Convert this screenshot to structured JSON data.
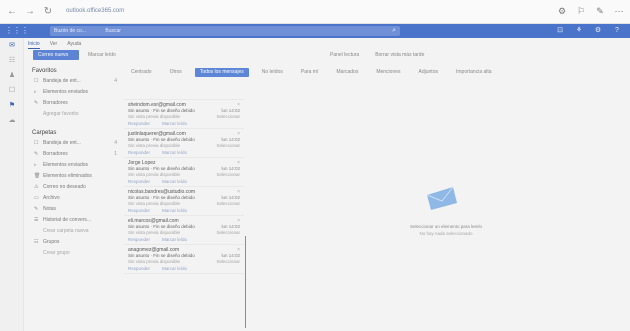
{
  "browser": {
    "url": "outlook.office365.com",
    "nav": [
      "←",
      "→",
      "↻"
    ],
    "right_icons": [
      "⚙",
      "⚐",
      "✎",
      "⋯"
    ]
  },
  "topbar": {
    "apps_icon": "⋮⋮⋮",
    "search_scope": "Buzón de co...",
    "search_placeholder": "Buscar",
    "right_icons": [
      "⊡",
      "⚘",
      "⚙",
      "?"
    ]
  },
  "rail": [
    "✉",
    "☷",
    "♟",
    "☐",
    "⚑",
    "☁"
  ],
  "ribbon": {
    "tabs": [
      "Inicio",
      "Ver",
      "Ayuda"
    ],
    "new_mail": "Correo nuevo",
    "mark_read": "Marcar leído"
  },
  "reading_opts": [
    "Panel lectura",
    "Borrar vista más tarde"
  ],
  "filters": [
    {
      "label": "Centrado",
      "primary": false
    },
    {
      "label": "Otros",
      "primary": false
    },
    {
      "label": "Todos los mensajes",
      "primary": true
    },
    {
      "label": "No leídos",
      "primary": false
    },
    {
      "label": "Para mí",
      "primary": false
    },
    {
      "label": "Marcados",
      "primary": false
    },
    {
      "label": "Menciones",
      "primary": false
    },
    {
      "label": "Adjuntos",
      "primary": false
    },
    {
      "label": "Importancia alta",
      "primary": false
    }
  ],
  "favorites": {
    "title": "Favoritos",
    "items": [
      {
        "icon": "☐",
        "label": "Bandeja de ent...",
        "count": "4"
      },
      {
        "icon": "▹",
        "label": "Elementos enviados",
        "count": ""
      },
      {
        "icon": "✎",
        "label": "Borradores",
        "count": ""
      },
      {
        "icon": "",
        "label": "Agregar favorito",
        "count": "",
        "dim": true
      }
    ]
  },
  "mailbox": {
    "title": "Carpetas",
    "items": [
      {
        "icon": "☐",
        "label": "Bandeja de ent...",
        "count": "4"
      },
      {
        "icon": "✎",
        "label": "Borradores",
        "count": "1"
      },
      {
        "icon": "▹",
        "label": "Elementos enviados",
        "count": ""
      },
      {
        "icon": "🗑",
        "label": "Elementos eliminados",
        "count": ""
      },
      {
        "icon": "⚠",
        "label": "Correo no deseado",
        "count": ""
      },
      {
        "icon": "▭",
        "label": "Archivo",
        "count": ""
      },
      {
        "icon": "✎",
        "label": "Notas",
        "count": ""
      },
      {
        "icon": "☰",
        "label": "Historial de convers...",
        "count": ""
      },
      {
        "icon": "",
        "label": "Crear carpeta nueva",
        "count": "",
        "dim": true
      },
      {
        "icon": "☷",
        "label": "Grupos",
        "count": ""
      },
      {
        "icon": "",
        "label": "Crear grupo",
        "count": "",
        "dim": true
      }
    ]
  },
  "messages": [
    {
      "sender": "",
      "subject": "",
      "time": "",
      "meta": "",
      "tag": ""
    },
    {
      "sender": "sheindom.esr@gmail.com",
      "subject": "Sin asunto · Fin se diseño debido",
      "time": "lun 14:02",
      "meta": "Sin vista previa disponible",
      "tag": "Seleccionar"
    },
    {
      "sender": "justinlaquerer@gmail.com",
      "subject": "Sin asunto · Fin se diseño debido",
      "time": "lun 14:02",
      "meta": "Sin vista previa disponible",
      "tag": "Seleccionar"
    },
    {
      "sender": "Jorge Lopez",
      "subject": "Sin asunto · Fin se diseño debido",
      "time": "lun 14:02",
      "meta": "Sin vista previa disponible",
      "tag": "Seleccionar"
    },
    {
      "sender": "nicolas.bandres@ustudio.com",
      "subject": "Sin asunto · Fin se diseño debido",
      "time": "lun 14:02",
      "meta": "Sin vista previa disponible",
      "tag": "Seleccionar"
    },
    {
      "sender": "eli.marcos@gmail.com",
      "subject": "Sin asunto · Fin se diseño debido",
      "time": "lun 14:02",
      "meta": "Sin vista previa disponible",
      "tag": "Seleccionar"
    },
    {
      "sender": "anagomez@gmail.com",
      "subject": "Sin asunto · Fin se diseño debido",
      "time": "lun 14:02",
      "meta": "Sin vista previa disponible",
      "tag": "Seleccionar"
    }
  ],
  "actions": [
    "Responder",
    "Marcar leído"
  ],
  "empty": {
    "line1": "Seleccionar un elemento para leerlo",
    "line2": "No hay nada seleccionado"
  }
}
